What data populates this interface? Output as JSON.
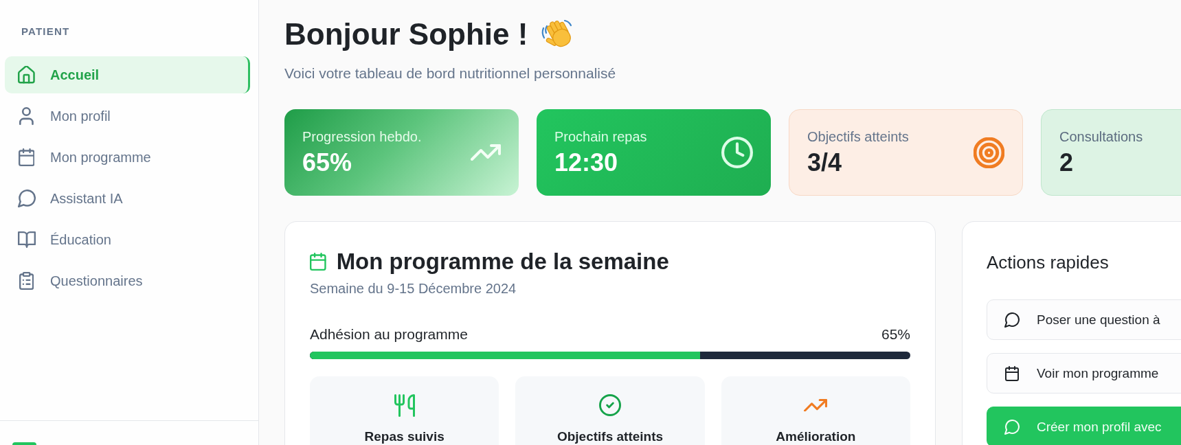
{
  "sidebar": {
    "section_label": "PATIENT",
    "items": [
      {
        "kind": "home",
        "label": "Accueil",
        "selected": true
      },
      {
        "kind": "profile",
        "label": "Mon profil",
        "selected": false
      },
      {
        "kind": "program",
        "label": "Mon programme",
        "selected": false
      },
      {
        "kind": "assistant",
        "label": "Assistant IA",
        "selected": false
      },
      {
        "kind": "education",
        "label": "Éducation",
        "selected": false
      },
      {
        "kind": "questionnaires",
        "label": "Questionnaires",
        "selected": false
      }
    ]
  },
  "header": {
    "title": "Bonjour Sophie !",
    "subtitle": "Voici votre tableau de bord nutritionnel personnalisé"
  },
  "stat_cards": [
    {
      "kind": "gradient",
      "label": "Progression hebdo.",
      "value": "65%"
    },
    {
      "kind": "solid",
      "label": "Prochain repas",
      "value": "12:30"
    },
    {
      "kind": "peach",
      "label": "Objectifs atteints",
      "value": "3/4"
    },
    {
      "kind": "mint",
      "label": "Consultations",
      "value": "2"
    }
  ],
  "program_card": {
    "title": "Mon programme de la semaine",
    "subtitle": "Semaine du 9-15 Décembre 2024",
    "adherence": {
      "label": "Adhésion au programme",
      "reading": "65%",
      "level": 0.65
    },
    "tiles": [
      {
        "kind": "meals",
        "label": "Repas suivis"
      },
      {
        "kind": "goals",
        "label": "Objectifs atteints"
      },
      {
        "kind": "progress",
        "label": "Amélioration"
      }
    ]
  },
  "quick_actions": {
    "title": "Actions rapides",
    "buttons": [
      {
        "kind": "ask",
        "label": "Poser une question à",
        "primary": false
      },
      {
        "kind": "program",
        "label": "Voir mon programme",
        "primary": false
      },
      {
        "kind": "create",
        "label": "Créer mon profil avec",
        "primary": true
      }
    ]
  }
}
